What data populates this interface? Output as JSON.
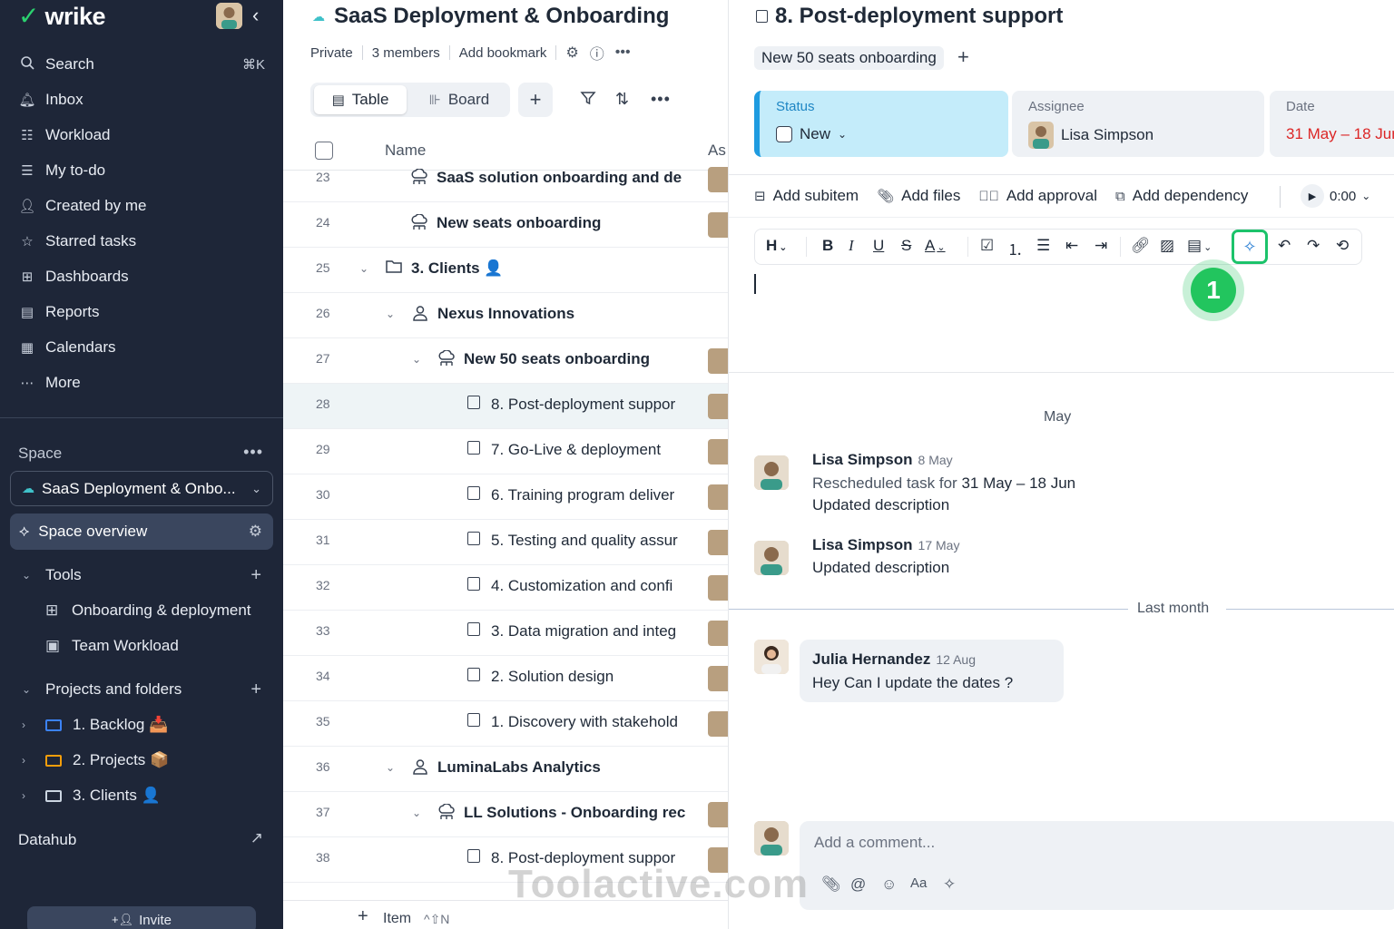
{
  "app": {
    "brand": "wrike"
  },
  "sidebar": {
    "nav": [
      {
        "label": "Search",
        "icon": "search-icon",
        "shortcut": "⌘K"
      },
      {
        "label": "Inbox",
        "icon": "bell-icon"
      },
      {
        "label": "Workload",
        "icon": "workload-icon"
      },
      {
        "label": "My to-do",
        "icon": "user-list-icon"
      },
      {
        "label": "Created by me",
        "icon": "user-edit-icon"
      },
      {
        "label": "Starred tasks",
        "icon": "star-icon"
      },
      {
        "label": "Dashboards",
        "icon": "dashboard-icon"
      },
      {
        "label": "Reports",
        "icon": "report-icon"
      },
      {
        "label": "Calendars",
        "icon": "calendar-icon"
      },
      {
        "label": "More",
        "icon": "more-icon"
      }
    ],
    "space_label": "Space",
    "space_name": "SaaS Deployment & Onbo...",
    "space_overview": "Space overview",
    "tools_label": "Tools",
    "tools": [
      {
        "label": "Onboarding & deployment",
        "icon": "board-icon"
      },
      {
        "label": "Team Workload",
        "icon": "workload-icon"
      }
    ],
    "projects_label": "Projects and folders",
    "folders": [
      {
        "label": "1. Backlog 📥",
        "color": "#3b82f6"
      },
      {
        "label": "2. Projects 📦",
        "color": "#f59e0b"
      },
      {
        "label": "3. Clients 👤",
        "color": "#cbd5e1"
      }
    ],
    "datahub": "Datahub",
    "invite": "Invite"
  },
  "project": {
    "title": "SaaS Deployment & Onboarding",
    "privacy": "Private",
    "members": "3 members",
    "bookmark": "Add bookmark",
    "views": {
      "table": "Table",
      "board": "Board",
      "active": "Table"
    },
    "columns": {
      "name": "Name",
      "assignee": "As"
    },
    "rows": [
      {
        "num": "23",
        "name": "SaaS solution onboarding and de",
        "icon": "project-icon",
        "bold": true
      },
      {
        "num": "24",
        "name": "New seats onboarding",
        "icon": "project-icon",
        "bold": true
      },
      {
        "num": "25",
        "name": "3. Clients 👤",
        "icon": "folder-icon",
        "bold": true
      },
      {
        "num": "26",
        "name": "Nexus Innovations",
        "icon": "person-icon",
        "bold": true
      },
      {
        "num": "27",
        "name": "New 50 seats onboarding",
        "icon": "project-icon",
        "bold": true
      },
      {
        "num": "28",
        "name": "8. Post-deployment suppor",
        "icon": "task-icon",
        "bold": false,
        "selected": true
      },
      {
        "num": "29",
        "name": "7. Go-Live & deployment",
        "icon": "task-icon",
        "bold": false
      },
      {
        "num": "30",
        "name": "6. Training program deliver",
        "icon": "task-icon",
        "bold": false
      },
      {
        "num": "31",
        "name": "5. Testing and quality assur",
        "icon": "task-icon",
        "bold": false
      },
      {
        "num": "32",
        "name": "4. Customization and confi",
        "icon": "task-icon",
        "bold": false
      },
      {
        "num": "33",
        "name": "3. Data migration and integ",
        "icon": "task-icon",
        "bold": false
      },
      {
        "num": "34",
        "name": "2. Solution design",
        "icon": "task-icon",
        "bold": false
      },
      {
        "num": "35",
        "name": "1. Discovery with stakehold",
        "icon": "task-icon",
        "bold": false
      },
      {
        "num": "36",
        "name": "LuminaLabs Analytics",
        "icon": "person-icon",
        "bold": true
      },
      {
        "num": "37",
        "name": "LL Solutions - Onboarding rec",
        "icon": "project-icon",
        "bold": true
      },
      {
        "num": "38",
        "name": "8. Post-deployment suppor",
        "icon": "task-icon",
        "bold": false
      }
    ],
    "add_item": "Item",
    "add_item_shortcut": "^⇧N"
  },
  "task": {
    "title": "8. Post-deployment support",
    "tag": "New 50 seats onboarding",
    "status_label": "Status",
    "status_value": "New",
    "assignee_label": "Assignee",
    "assignee_value": "Lisa Simpson",
    "date_label": "Date",
    "date_value": "31 May – 18 Jun",
    "actions": {
      "subitem": "Add subitem",
      "files": "Add files",
      "approval": "Add approval",
      "dependency": "Add dependency"
    },
    "timer": "0:00",
    "step_badge": "1",
    "activity": {
      "month": "May",
      "entries": [
        {
          "author": "Lisa Simpson",
          "date": "8 May",
          "line1_prefix": "Rescheduled task for",
          "line1_value": "31 May – 18 Jun",
          "line2": "Updated description"
        },
        {
          "author": "Lisa Simpson",
          "date": "17 May",
          "line2": "Updated description"
        }
      ],
      "separator": "Last month",
      "comment": {
        "author": "Julia Hernandez",
        "date": "12 Aug",
        "text": "Hey Can I update the dates ?"
      }
    },
    "comment_placeholder": "Add a comment...",
    "watermark": "Toolactive.com"
  },
  "colors": {
    "accent_green": "#1cc36b",
    "status_blue": "#1e9be0",
    "date_red": "#dc2626"
  }
}
